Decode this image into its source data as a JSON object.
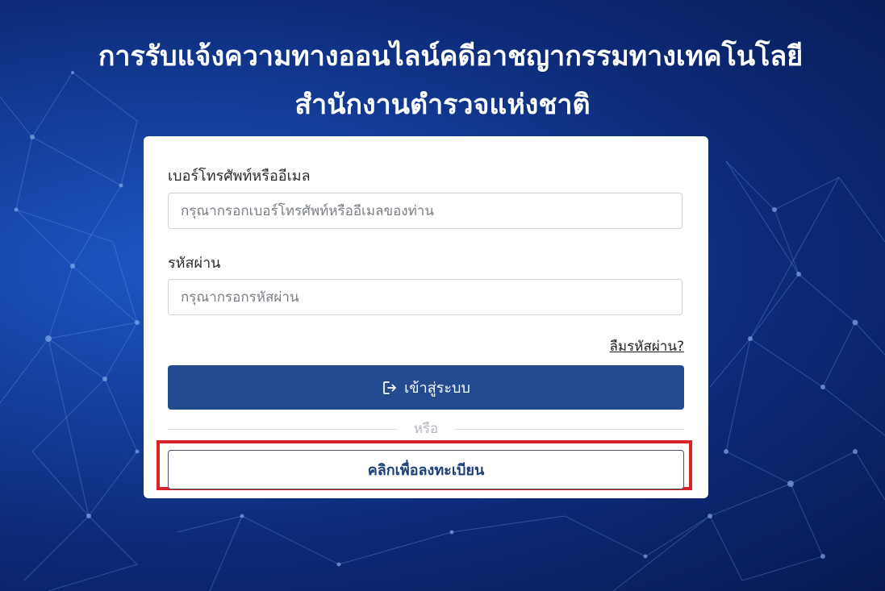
{
  "header": {
    "title_line1": "การรับแจ้งความทางออนไลน์คดีอาชญากรรมทางเทคโนโลยี",
    "title_line2": "สำนักงานตำรวจแห่งชาติ"
  },
  "login_form": {
    "username_label": "เบอร์โทรศัพท์หรืออีเมล",
    "username_placeholder": "กรุณากรอกเบอร์โทรศัพท์หรืออีเมลของท่าน",
    "username_value": "",
    "password_label": "รหัสผ่าน",
    "password_placeholder": "กรุณากรอกรหัสผ่าน",
    "password_value": "",
    "forgot_password_label": "ลืมรหัสผ่าน?",
    "login_button_label": "เข้าสู่ระบบ",
    "login_icon": "sign-in-icon",
    "divider_label": "หรือ",
    "register_button_label": "คลิกเพื่อลงทะเบียน"
  },
  "colors": {
    "primary_button": "#244a8f",
    "highlight_border": "#d9232a",
    "background_dark": "#0d2a78"
  }
}
